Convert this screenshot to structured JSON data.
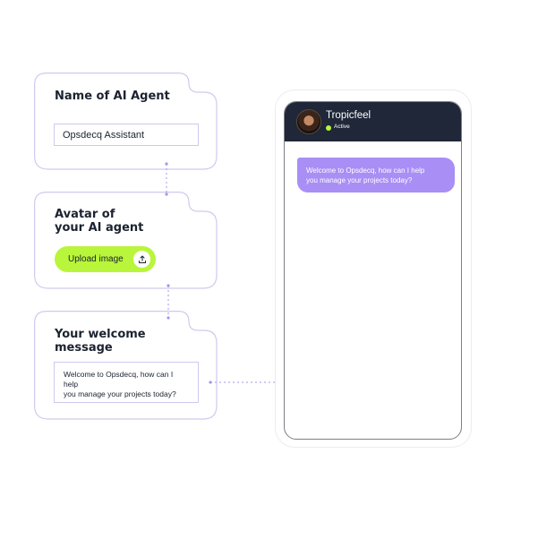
{
  "cards": {
    "agent_name": {
      "title": "Name of AI Agent",
      "input_value": "Opsdecq Assistant"
    },
    "avatar": {
      "title_line1": "Avatar of",
      "title_line2": "your AI agent",
      "upload_label": "Upload image",
      "upload_icon": "upload-icon"
    },
    "welcome": {
      "title_line1": "Your welcome",
      "title_line2": "message",
      "message_line1": "Welcome to Opsdecq, how can I help",
      "message_line2": "you manage your projects today?"
    }
  },
  "phone": {
    "agent_name": "Tropicfeel",
    "status": "Active",
    "welcome_line1": "Welcome to Opsdecq, how can I help",
    "welcome_line2": "you manage your projects today?"
  },
  "colors": {
    "accent_green": "#b9f53b",
    "accent_purple": "#a88ef5",
    "outline": "#cfc9ef",
    "dark_header": "#1f2738",
    "text": "#1b2230"
  }
}
